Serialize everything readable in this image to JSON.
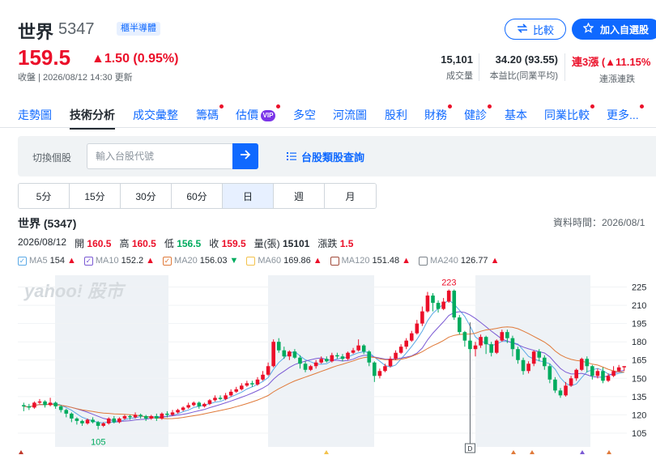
{
  "header": {
    "name": "世界",
    "code": "5347",
    "badge": "櫃半導體",
    "compare_label": "比較",
    "add_watchlist_label": "加入自選股"
  },
  "quote": {
    "price": "159.5",
    "change": "▲1.50 (0.95%)",
    "as_of": "收盤 | 2026/08/12 14:30 更新"
  },
  "stats": [
    {
      "value": "15,101",
      "label": "成交量"
    },
    {
      "value": "34.20 (93.55)",
      "label": "本益比(同業平均)"
    },
    {
      "value_prefix": "連3漲 (",
      "value_change": "▲11.15%",
      "label": "連漲連跌"
    }
  ],
  "nav_tabs": [
    {
      "label": "走勢圖",
      "dot": false
    },
    {
      "label": "技術分析",
      "dot": false,
      "active": true
    },
    {
      "label": "成交彙整",
      "dot": false
    },
    {
      "label": "籌碼",
      "dot": true
    },
    {
      "label": "估價",
      "dot": true,
      "vip": "VIP"
    },
    {
      "label": "多空",
      "dot": false
    },
    {
      "label": "河流圖",
      "dot": false
    },
    {
      "label": "股利",
      "dot": false
    },
    {
      "label": "財務",
      "dot": true
    },
    {
      "label": "健診",
      "dot": true
    },
    {
      "label": "基本",
      "dot": false
    },
    {
      "label": "同業比較",
      "dot": true
    },
    {
      "label": "更多...",
      "dot": true
    }
  ],
  "stock_switch": {
    "label": "切換個股",
    "placeholder": "輸入台股代號",
    "category_link": "台股類股查詢"
  },
  "periods": [
    "5分",
    "15分",
    "30分",
    "60分",
    "日",
    "週",
    "月"
  ],
  "selected_period": "日",
  "chart_header": {
    "title": "世界 (5347)",
    "data_time": "資料時間：2026/08/1",
    "date": "2026/08/12",
    "open_label": "開",
    "open": "160.5",
    "high_label": "高",
    "high": "160.5",
    "low_label": "低",
    "low": "156.5",
    "close_label": "收",
    "close": "159.5",
    "volume_label": "量(張)",
    "volume": "15101",
    "change_label": "漲跌",
    "change": "1.5"
  },
  "ma_legend": [
    {
      "name": "MA5",
      "value": "154",
      "dir": "▲",
      "color": "#5aa9e6"
    },
    {
      "name": "MA10",
      "value": "152.2",
      "dir": "▲",
      "color": "#7b5ad4"
    },
    {
      "name": "MA20",
      "value": "156.03",
      "dir": "▼",
      "color": "#e07a3a"
    },
    {
      "name": "MA60",
      "value": "169.86",
      "dir": "▲",
      "color": "#f3c24c"
    },
    {
      "name": "MA120",
      "value": "151.48",
      "dir": "▲",
      "color": "#a14b3a"
    },
    {
      "name": "MA240",
      "value": "126.77",
      "dir": "▲",
      "color": "#7d858c"
    }
  ],
  "colors": {
    "up": "#eb0f29",
    "down": "#00ab5e",
    "accent": "#0f69ff"
  },
  "chart_data": {
    "type": "candlestick",
    "watermark": "yahoo! 股市",
    "y_ticks": [
      225,
      210,
      195,
      180,
      165,
      150,
      135,
      120,
      105
    ],
    "ylim": [
      95,
      232
    ],
    "high_label": "223",
    "low_label": "105",
    "event_label": "D",
    "candles": [
      [
        128,
        127,
        130,
        123
      ],
      [
        127,
        126,
        129,
        124
      ],
      [
        126,
        130,
        131,
        125
      ],
      [
        130,
        131,
        133,
        129
      ],
      [
        131,
        128,
        132,
        126
      ],
      [
        128,
        130,
        134,
        127
      ],
      [
        130,
        127,
        131,
        125
      ],
      [
        127,
        124,
        128,
        122
      ],
      [
        124,
        121,
        125,
        118
      ],
      [
        121,
        117,
        122,
        114
      ],
      [
        117,
        115,
        118,
        112
      ],
      [
        115,
        113,
        116,
        111
      ],
      [
        113,
        116,
        117,
        112
      ],
      [
        116,
        114,
        118,
        113
      ],
      [
        114,
        111,
        115,
        108
      ],
      [
        111,
        113,
        114,
        110
      ],
      [
        113,
        117,
        118,
        112
      ],
      [
        117,
        114,
        119,
        113
      ],
      [
        114,
        117,
        118,
        113
      ],
      [
        117,
        119,
        120,
        116
      ],
      [
        119,
        118,
        120,
        116
      ],
      [
        118,
        120,
        122,
        117
      ],
      [
        120,
        119,
        121,
        117
      ],
      [
        119,
        117,
        120,
        115
      ],
      [
        117,
        119,
        120,
        116
      ],
      [
        119,
        117,
        121,
        115
      ],
      [
        117,
        121,
        122,
        116
      ],
      [
        121,
        120,
        123,
        118
      ],
      [
        120,
        122,
        124,
        119
      ],
      [
        122,
        124,
        125,
        121
      ],
      [
        124,
        126,
        127,
        123
      ],
      [
        126,
        128,
        130,
        125
      ],
      [
        128,
        130,
        131,
        127
      ],
      [
        130,
        127,
        131,
        125
      ],
      [
        127,
        129,
        130,
        126
      ],
      [
        129,
        132,
        133,
        128
      ],
      [
        132,
        134,
        136,
        131
      ],
      [
        134,
        133,
        136,
        132
      ],
      [
        133,
        136,
        138,
        132
      ],
      [
        136,
        139,
        141,
        135
      ],
      [
        139,
        141,
        143,
        138
      ],
      [
        141,
        144,
        146,
        140
      ],
      [
        144,
        146,
        148,
        143
      ],
      [
        146,
        145,
        148,
        143
      ],
      [
        145,
        149,
        151,
        144
      ],
      [
        149,
        153,
        156,
        148
      ],
      [
        153,
        160,
        163,
        152
      ],
      [
        160,
        180,
        182,
        159
      ],
      [
        180,
        173,
        183,
        171
      ],
      [
        173,
        168,
        176,
        166
      ],
      [
        168,
        172,
        173,
        165
      ],
      [
        172,
        167,
        174,
        166
      ],
      [
        167,
        162,
        169,
        158
      ],
      [
        162,
        157,
        164,
        155
      ],
      [
        157,
        160,
        161,
        156
      ],
      [
        160,
        163,
        165,
        158
      ],
      [
        163,
        166,
        168,
        162
      ],
      [
        166,
        164,
        168,
        163
      ],
      [
        164,
        169,
        171,
        163
      ],
      [
        169,
        168,
        171,
        166
      ],
      [
        168,
        166,
        170,
        164
      ],
      [
        166,
        171,
        172,
        165
      ],
      [
        171,
        173,
        175,
        170
      ],
      [
        173,
        177,
        182,
        172
      ],
      [
        177,
        172,
        178,
        170
      ],
      [
        172,
        163,
        173,
        160
      ],
      [
        163,
        152,
        164,
        147
      ],
      [
        152,
        156,
        158,
        150
      ],
      [
        156,
        160,
        162,
        155
      ],
      [
        160,
        166,
        168,
        159
      ],
      [
        166,
        171,
        173,
        165
      ],
      [
        171,
        176,
        178,
        170
      ],
      [
        176,
        181,
        183,
        174
      ],
      [
        181,
        187,
        189,
        180
      ],
      [
        187,
        195,
        198,
        186
      ],
      [
        195,
        205,
        209,
        193
      ],
      [
        205,
        218,
        221,
        204
      ],
      [
        218,
        212,
        220,
        205
      ],
      [
        212,
        207,
        214,
        204
      ],
      [
        207,
        213,
        216,
        206
      ],
      [
        213,
        222,
        223,
        212
      ],
      [
        222,
        200,
        223,
        198
      ],
      [
        200,
        188,
        202,
        186
      ],
      [
        188,
        181,
        189,
        176
      ],
      [
        181,
        174,
        183,
        171
      ],
      [
        174,
        177,
        180,
        168
      ],
      [
        177,
        184,
        186,
        175
      ],
      [
        184,
        178,
        185,
        170
      ],
      [
        178,
        171,
        180,
        168
      ],
      [
        171,
        181,
        182,
        170
      ],
      [
        181,
        188,
        190,
        180
      ],
      [
        188,
        183,
        190,
        179
      ],
      [
        183,
        174,
        185,
        168
      ],
      [
        174,
        165,
        176,
        162
      ],
      [
        165,
        156,
        167,
        153
      ],
      [
        156,
        162,
        164,
        154
      ],
      [
        162,
        172,
        173,
        160
      ],
      [
        172,
        167,
        174,
        164
      ],
      [
        167,
        160,
        169,
        157
      ],
      [
        160,
        149,
        162,
        146
      ],
      [
        149,
        140,
        151,
        138
      ],
      [
        140,
        136,
        142,
        134
      ],
      [
        136,
        144,
        147,
        135
      ],
      [
        144,
        150,
        152,
        143
      ],
      [
        150,
        157,
        158,
        148
      ],
      [
        157,
        166,
        167,
        156
      ],
      [
        166,
        160,
        168,
        155
      ],
      [
        160,
        152,
        161,
        149
      ],
      [
        152,
        156,
        158,
        150
      ],
      [
        156,
        148,
        159,
        146
      ],
      [
        148,
        152,
        154,
        147
      ],
      [
        152,
        156,
        160,
        151
      ],
      [
        156,
        159,
        161,
        155
      ],
      [
        159,
        160,
        160,
        156
      ]
    ]
  }
}
